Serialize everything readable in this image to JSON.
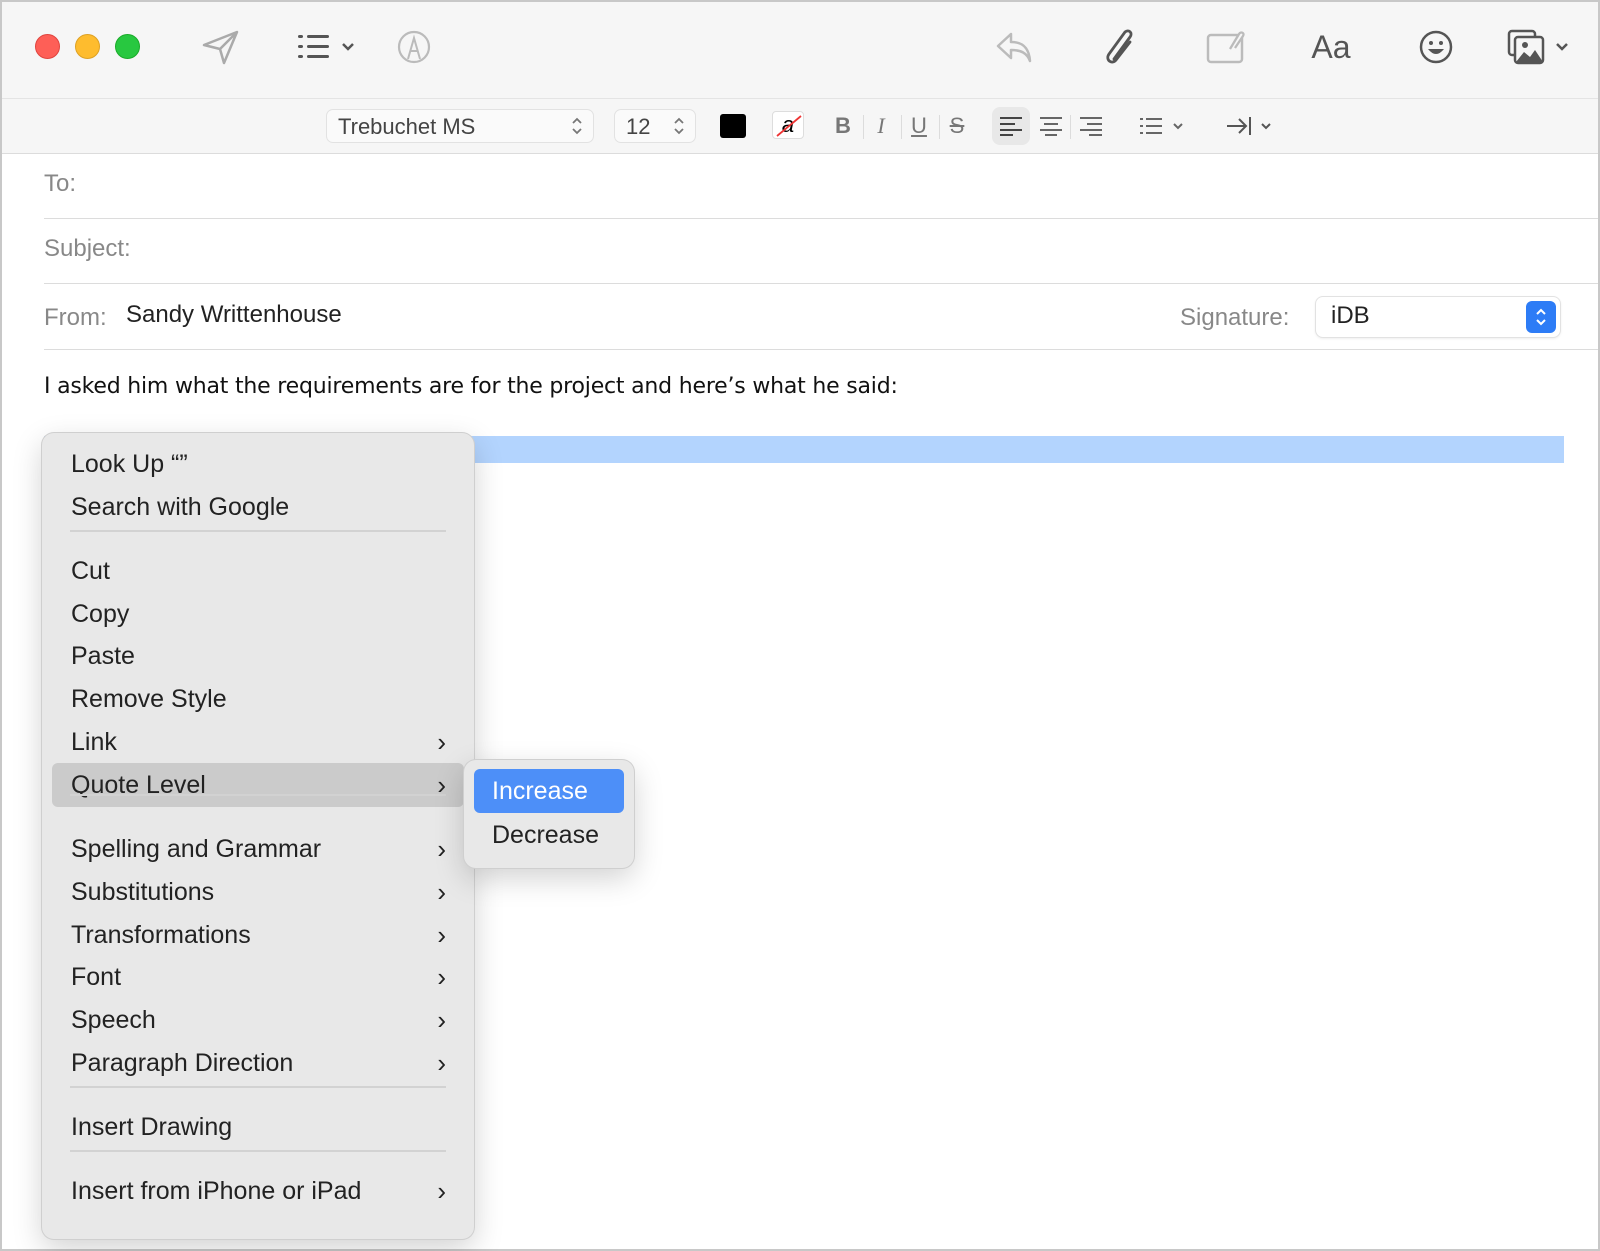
{
  "window": {
    "traffic_lights": [
      "close",
      "minimize",
      "zoom"
    ]
  },
  "toolbar": {
    "icons": {
      "send": "paper-plane-icon",
      "header_fields": "list-icon",
      "markup": "markup-icon",
      "reply": "reply-icon",
      "attach": "paperclip-icon",
      "attach_annotate": "attachment-annotate-icon",
      "format": "Aa",
      "emoji": "smiley-icon",
      "photo": "photo-browser-icon"
    }
  },
  "format_bar": {
    "font": "Trebuchet MS",
    "size": "12",
    "text_color": "#000000",
    "bold": "B",
    "italic": "I",
    "underline": "U",
    "strikethrough": "S",
    "bg_glyph": "a"
  },
  "fields": {
    "to_label": "To:",
    "to_value": "",
    "subject_label": "Subject:",
    "subject_value": "",
    "from_label": "From:",
    "from_value": "Sandy Writtenhouse",
    "signature_label": "Signature:",
    "signature_value": "iDB"
  },
  "body": {
    "text": "I asked him what the requirements are for the project and here’s what he said:"
  },
  "context_menu": {
    "items": [
      {
        "label": "Look Up “”",
        "submenu": false
      },
      {
        "label": "Search with Google",
        "submenu": false
      },
      {
        "label": "Cut",
        "submenu": false
      },
      {
        "label": "Copy",
        "submenu": false
      },
      {
        "label": "Paste",
        "submenu": false
      },
      {
        "label": "Remove Style",
        "submenu": false
      },
      {
        "label": "Link",
        "submenu": true
      },
      {
        "label": "Quote Level",
        "submenu": true,
        "highlighted": true
      },
      {
        "label": "Spelling and Grammar",
        "submenu": true
      },
      {
        "label": "Substitutions",
        "submenu": true
      },
      {
        "label": "Transformations",
        "submenu": true
      },
      {
        "label": "Font",
        "submenu": true
      },
      {
        "label": "Speech",
        "submenu": true
      },
      {
        "label": "Paragraph Direction",
        "submenu": true
      },
      {
        "label": "Insert Drawing",
        "submenu": false
      },
      {
        "label": "Insert from iPhone or iPad",
        "submenu": true
      }
    ],
    "chevron": "›"
  },
  "submenu": {
    "items": [
      {
        "label": "Increase",
        "active": true
      },
      {
        "label": "Decrease",
        "active": false
      }
    ]
  },
  "colors": {
    "accent": "#4d8ff8",
    "selection": "#b3d4fe",
    "signature_stepper": "#2d7cf6"
  }
}
